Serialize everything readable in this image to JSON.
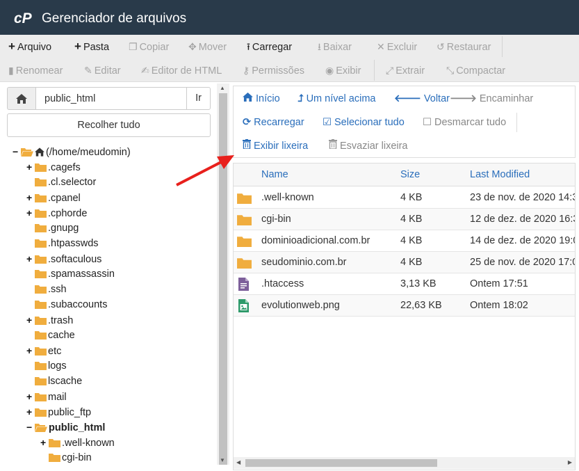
{
  "app": {
    "title": "Gerenciador de arquivos"
  },
  "toolbar": {
    "row1": [
      {
        "label": "Arquivo",
        "icon": "plus-icon",
        "enabled": true
      },
      {
        "label": "Pasta",
        "icon": "plus-icon",
        "enabled": true
      },
      {
        "label": "Copiar",
        "icon": "copy-icon",
        "enabled": false
      },
      {
        "label": "Mover",
        "icon": "move-icon",
        "enabled": false
      },
      {
        "label": "Carregar",
        "icon": "upload-icon",
        "enabled": true
      },
      {
        "label": "Baixar",
        "icon": "download-icon",
        "enabled": false
      },
      {
        "label": "Excluir",
        "icon": "close-icon",
        "enabled": false
      },
      {
        "label": "Restaurar",
        "icon": "undo-icon",
        "enabled": false
      }
    ],
    "row2": [
      {
        "label": "Renomear",
        "icon": "file-icon",
        "enabled": false
      },
      {
        "label": "Editar",
        "icon": "pencil-icon",
        "enabled": false
      },
      {
        "label": "Editor de HTML",
        "icon": "edit-icon",
        "enabled": false
      },
      {
        "label": "Permissões",
        "icon": "key-icon",
        "enabled": false
      },
      {
        "label": "Exibir",
        "icon": "eye-icon",
        "enabled": false
      },
      {
        "label": "Extrair",
        "icon": "expand-icon",
        "enabled": false
      },
      {
        "label": "Compactar",
        "icon": "compress-icon",
        "enabled": false
      }
    ]
  },
  "left": {
    "path_value": "public_html",
    "go_label": "Ir",
    "collapse_label": "Recolher tudo",
    "tree": [
      {
        "label": "(/home/meudomin)",
        "toggle": "−",
        "open": true,
        "home": true
      },
      {
        "label": ".cagefs",
        "toggle": "+"
      },
      {
        "label": ".cl.selector",
        "toggle": ""
      },
      {
        "label": ".cpanel",
        "toggle": "+"
      },
      {
        "label": ".cphorde",
        "toggle": "+"
      },
      {
        "label": ".gnupg",
        "toggle": ""
      },
      {
        "label": ".htpasswds",
        "toggle": ""
      },
      {
        "label": ".softaculous",
        "toggle": "+"
      },
      {
        "label": ".spamassassin",
        "toggle": ""
      },
      {
        "label": ".ssh",
        "toggle": ""
      },
      {
        "label": ".subaccounts",
        "toggle": ""
      },
      {
        "label": ".trash",
        "toggle": "+"
      },
      {
        "label": "cache",
        "toggle": ""
      },
      {
        "label": "etc",
        "toggle": "+"
      },
      {
        "label": "logs",
        "toggle": ""
      },
      {
        "label": "lscache",
        "toggle": ""
      },
      {
        "label": "mail",
        "toggle": "+"
      },
      {
        "label": "public_ftp",
        "toggle": "+"
      },
      {
        "label": "public_html",
        "toggle": "−",
        "open": true,
        "bold": true
      },
      {
        "label": ".well-known",
        "toggle": "+"
      },
      {
        "label": "cgi-bin",
        "toggle": ""
      }
    ]
  },
  "nav": {
    "home": "Início",
    "up": "Um nível acima",
    "back": "Voltar",
    "forward": "Encaminhar",
    "reload": "Recarregar",
    "select_all": "Selecionar tudo",
    "unselect_all": "Desmarcar tudo",
    "view_trash": "Exibir lixeira",
    "empty_trash": "Esvaziar lixeira"
  },
  "table": {
    "headers": {
      "name": "Name",
      "size": "Size",
      "modified": "Last Modified"
    },
    "rows": [
      {
        "type": "folder",
        "name": ".well-known",
        "size": "4 KB",
        "modified": "23 de nov. de 2020 14:3"
      },
      {
        "type": "folder",
        "name": "cgi-bin",
        "size": "4 KB",
        "modified": "12 de dez. de 2020 16:3"
      },
      {
        "type": "folder",
        "name": "dominioadicional.com.br",
        "size": "4 KB",
        "modified": "14 de dez. de 2020 19:0"
      },
      {
        "type": "folder",
        "name": "seudominio.com.br",
        "size": "4 KB",
        "modified": "25 de nov. de 2020 17:0"
      },
      {
        "type": "text",
        "name": ".htaccess",
        "size": "3,13 KB",
        "modified": "Ontem 17:51"
      },
      {
        "type": "image",
        "name": "evolutionweb.png",
        "size": "22,63 KB",
        "modified": "Ontem 18:02"
      }
    ]
  },
  "colors": {
    "header_bg": "#293a4a",
    "link_blue": "#2a6ebb",
    "folder_yellow": "#f0ad3e",
    "annotation_red": "#e8201c"
  }
}
